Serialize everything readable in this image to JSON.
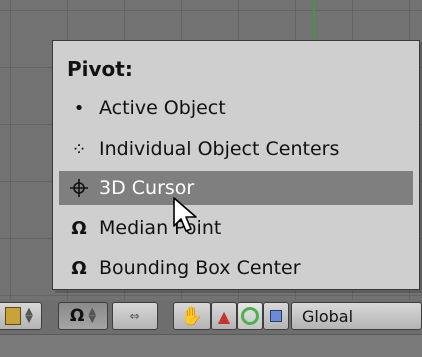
{
  "menu": {
    "title": "Pivot:",
    "items": [
      {
        "label": "Active Object",
        "icon": "active-object-dot-icon",
        "glyph": "•",
        "highlighted": false
      },
      {
        "label": "Individual Object Centers",
        "icon": "individual-centers-icon",
        "glyph": "⁘",
        "highlighted": false
      },
      {
        "label": "3D Cursor",
        "icon": "crosshair-icon",
        "glyph": "⌖",
        "highlighted": true
      },
      {
        "label": "Median Point",
        "icon": "median-point-icon",
        "glyph": "Ω",
        "highlighted": false
      },
      {
        "label": "Bounding Box Center",
        "icon": "bounding-box-center-icon",
        "glyph": "Ω",
        "highlighted": false
      }
    ]
  },
  "toolbar": {
    "orientation_value": "Global",
    "colors": {
      "highlight": "#7f7f7f",
      "manipulator_red": "#c83232",
      "manipulator_green": "#4fb04f",
      "manipulator_blue": "#6a8bdc",
      "axis_green": "#3f9a3f"
    }
  }
}
